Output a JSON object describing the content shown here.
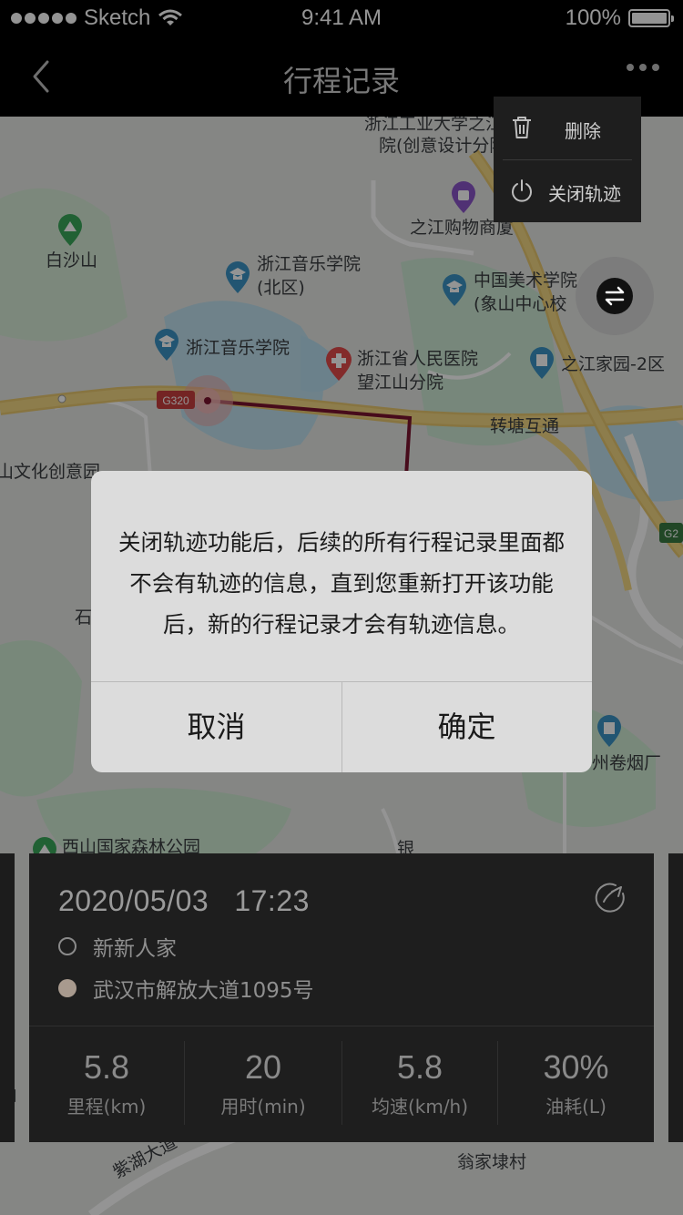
{
  "status_bar": {
    "carrier": "Sketch",
    "time": "9:41 AM",
    "battery": "100%"
  },
  "nav": {
    "title": "行程记录",
    "back_icon": "chevron-left-icon",
    "more_icon": "more-horizontal-icon"
  },
  "menu": {
    "items": [
      {
        "label": "删除",
        "icon": "trash-icon"
      },
      {
        "label": "关闭轨迹",
        "icon": "power-icon"
      }
    ]
  },
  "map": {
    "labels": [
      {
        "text": "浙江工业大学之江"
      },
      {
        "text": "院(创意设计分院"
      },
      {
        "text": "之江购物商厦"
      },
      {
        "text": "白沙山"
      },
      {
        "text": "浙江音乐学院"
      },
      {
        "text": "(北区)"
      },
      {
        "text": "中国美术学院"
      },
      {
        "text": "(象山中心校"
      },
      {
        "text": "浙江音乐学院"
      },
      {
        "text": "浙江省人民医院"
      },
      {
        "text": "望江山分院"
      },
      {
        "text": "之江家园-2区"
      },
      {
        "text": "转塘互通"
      },
      {
        "text": "山文化创意园"
      },
      {
        "text": "G320"
      },
      {
        "text": "石"
      },
      {
        "text": "州卷烟厂"
      },
      {
        "text": "西山国家森林公园"
      },
      {
        "text": "翁家埭村"
      },
      {
        "text": "紫湖大道"
      },
      {
        "text": "G2"
      },
      {
        "text": "山"
      },
      {
        "text": "银"
      }
    ]
  },
  "dialog": {
    "message": "关闭轨迹功能后，后续的所有行程记录里面都不会有轨迹的信息，直到您重新打开该功能后，新的行程记录才会有轨迹信息。",
    "cancel_label": "取消",
    "confirm_label": "确定"
  },
  "trip": {
    "date": "2020/05/03",
    "time": "17:23",
    "start": "新新人家",
    "end": "武汉市解放大道1095号",
    "stats": [
      {
        "value": "5.8",
        "label": "里程(km)"
      },
      {
        "value": "20",
        "label": "用时(min)"
      },
      {
        "value": "5.8",
        "label": "均速(km/h)"
      },
      {
        "value": "30%",
        "label": "油耗(L)"
      }
    ]
  },
  "colors": {
    "route": "#7a1430",
    "road": "#f2d27c",
    "water": "#b9dff0",
    "park": "#cdebd0",
    "dialog_bg": "#dcdcdc",
    "card_bg": "#1e1e1e"
  }
}
